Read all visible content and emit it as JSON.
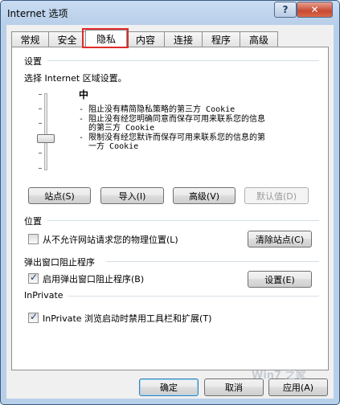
{
  "window": {
    "title": "Internet 选项"
  },
  "titlebar": {
    "help_glyph": "?",
    "close_glyph": "✕"
  },
  "tabs": [
    {
      "label": "常规"
    },
    {
      "label": "安全"
    },
    {
      "label": "隐私"
    },
    {
      "label": "内容"
    },
    {
      "label": "连接"
    },
    {
      "label": "程序"
    },
    {
      "label": "高级"
    }
  ],
  "settings": {
    "heading": "设置",
    "zone_prompt": "选择 Internet 区域设置。",
    "level_name": "中",
    "level_slider_position": "中",
    "description": [
      "- 阻止没有精简隐私策略的第三方 Cookie",
      "- 阻止没有经您明确同意而保存可用来联系您的信息",
      "  的第三方 Cookie",
      "- 限制没有经您默许而保存可用来联系您的信息的第",
      "  一方 Cookie"
    ],
    "buttons": {
      "sites": "站点(S)",
      "import": "导入(I)",
      "advanced": "高级(V)",
      "default": "默认值(D)"
    }
  },
  "location": {
    "heading": "位置",
    "never_allow_label": "从不允许网站请求您的物理位置(L)",
    "never_allow_checked": false,
    "clear_sites_button": "清除站点(C)"
  },
  "popup": {
    "heading": "弹出窗口阻止程序",
    "enable_label": "启用弹出窗口阻止程序(B)",
    "enable_checked": true,
    "settings_button": "设置(E)"
  },
  "inprivate": {
    "heading": "InPrivate",
    "disable_label": "InPrivate 浏览启动时禁用工具栏和扩展(T)",
    "disable_checked": true
  },
  "footer": {
    "ok": "确定",
    "cancel": "取消",
    "apply": "应用(A)"
  },
  "watermark": "Win7 之家"
}
